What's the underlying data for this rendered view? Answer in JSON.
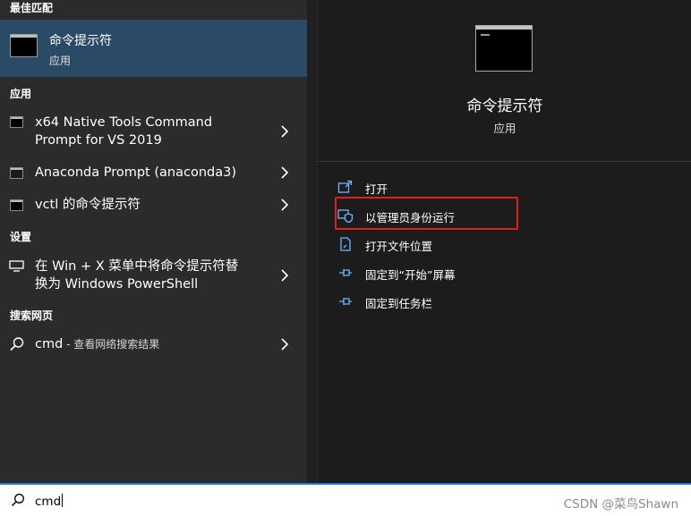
{
  "results": {
    "best_match_header": "最佳匹配",
    "best_match": {
      "name": "命令提示符",
      "type": "应用"
    },
    "apps_header": "应用",
    "apps": [
      {
        "line1": "x64 Native Tools Command",
        "line2": "Prompt for VS 2019"
      },
      {
        "line1": "Anaconda Prompt (anaconda3)"
      },
      {
        "line1": "vctl 的命令提示符"
      }
    ],
    "settings_header": "设置",
    "settings": [
      {
        "line1": "在 Win + X 菜单中将命令提示符替",
        "line2": "换为 Windows PowerShell"
      }
    ],
    "web_header": "搜索网页",
    "web": {
      "query": "cmd",
      "suffix": " - 查看网络搜索结果"
    }
  },
  "preview": {
    "title": "命令提示符",
    "subtitle": "应用",
    "actions": [
      {
        "label": "打开",
        "icon": "open-icon"
      },
      {
        "label": "以管理员身份运行",
        "icon": "admin-shield-icon"
      },
      {
        "label": "打开文件位置",
        "icon": "file-location-icon"
      },
      {
        "label": "固定到“开始”屏幕",
        "icon": "pin-icon"
      },
      {
        "label": "固定到任务栏",
        "icon": "pin-icon"
      }
    ]
  },
  "searchbar": {
    "query": "cmd",
    "watermark": "CSDN @菜鸟Shawn"
  },
  "colors": {
    "selected_bg": "#2a4a66",
    "accent": "#1e78d6",
    "highlight": "#e02020",
    "panel_left": "#2b2b2b",
    "panel_right": "#1c1c1c"
  }
}
